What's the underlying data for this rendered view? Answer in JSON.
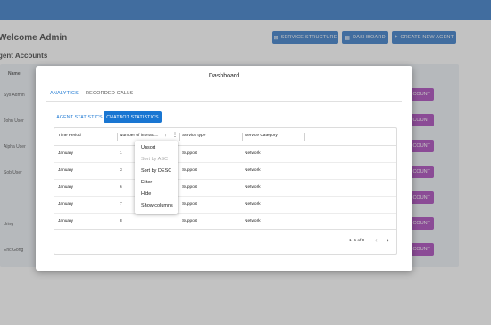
{
  "header": {
    "welcome": "Welcome Admin",
    "section_title": "gent Accounts",
    "buttons": [
      {
        "label": "SERVICE STRUCTURE",
        "icon": "structure-icon"
      },
      {
        "label": "DASHBOARD",
        "icon": "dashboard-icon"
      },
      {
        "label": "CREATE NEW AGENT",
        "icon": "plus-icon"
      }
    ]
  },
  "background_table": {
    "column_header": "Name",
    "names": [
      "Sys Admin",
      "John User",
      "Alpha User",
      "Sob User",
      "",
      "dring",
      "Eric Gong"
    ],
    "action_label": "COUNT"
  },
  "modal": {
    "title": "Dashboard",
    "tabs": [
      "ANALYTICS",
      "RECORDED CALLS"
    ],
    "subtabs": [
      "AGENT STATISTICS",
      "CHATBOT STATISTICS"
    ],
    "columns": [
      "Time Period",
      "Number of interact...",
      "Service type",
      "Service Category"
    ],
    "sort_indicator": "↑",
    "column_menu_glyph": "⋮",
    "rows": [
      {
        "period": "January",
        "number": "1",
        "type": "Support",
        "category": "Network"
      },
      {
        "period": "January",
        "number": "3",
        "type": "Support",
        "category": "Network"
      },
      {
        "period": "January",
        "number": "6",
        "type": "Support",
        "category": "Network"
      },
      {
        "period": "January",
        "number": "7",
        "type": "Support",
        "category": "Network"
      },
      {
        "period": "January",
        "number": "8",
        "type": "Support",
        "category": "Network"
      }
    ],
    "pagination": "1–5 of 9",
    "column_menu": [
      "Unsort",
      "Sort by ASC",
      "Sort by DESC",
      "Filter",
      "Hide",
      "Show columns"
    ]
  },
  "colors": {
    "primary": "#1565c0",
    "accent": "#1976d2",
    "count_button": "#9c27b0"
  }
}
